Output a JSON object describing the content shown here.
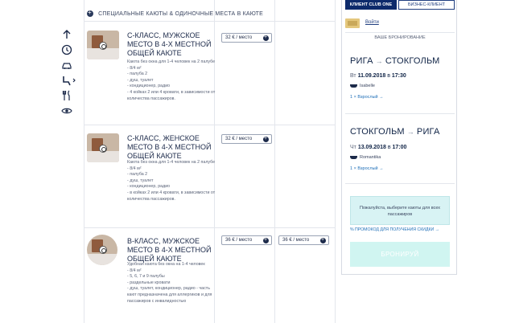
{
  "section_header": "СПЕЦИАЛЬНЫЕ КАЮТЫ & ОДИНОЧНЫЕ МЕСТА В КАЮТЕ",
  "side_nav_icons": [
    "arrow-up-icon",
    "clock-icon",
    "car-icon",
    "seat-icon",
    "restaurant-icon",
    "eye-icon"
  ],
  "cabins": [
    {
      "title": "С-КЛАСС, МУЖСКОЕ МЕСТО  В 4-Х МЕСТНОЙ ОБЩЕЙ КАЮТЕ",
      "description": "Каюта без окна для 1-4 человек на 2 палубе\n- 8/4 м²\n- палуба 2\n- душ, туалет\n- кондиционер, радио\n- 4 койках 2 или 4 кровати, в зависимости от количества пассажиров.",
      "price_outbound": "32 € / место",
      "price_return": ""
    },
    {
      "title": "С-КЛАСС, ЖЕНСКОЕ МЕСТО  В 4-Х МЕСТНОЙ ОБЩЕЙ КАЮТЕ",
      "description": "Каюта без окна для 1-4 человек на 2 палубе\n- 8/4 м²\n- палуба 2\n- душ, туалет\n- кондиционер, радио\n- в койках 2 или 4 кровати, в зависимости от количества пассажиров.",
      "price_outbound": "32 € / место",
      "price_return": ""
    },
    {
      "title": "В-КЛАСС, МУЖСКОЕ МЕСТО  В 4-Х МЕСТНОЙ ОБЩЕЙ КАЮТЕ",
      "description": "Удобная каюта без окна на 1-4 человек\n- 8/4 м²\n- 5, 6, 7 и 9 палубы\n- раздельные кровати\n- душ, туалет, кондиционер, радио - часть кают предназначена для аллергиков и для пассажиров с инвалидностью",
      "price_outbound": "36 € / место",
      "price_return": "36 € / место"
    }
  ],
  "panel": {
    "tab_club": "КЛИЕНТ CLUB ONE",
    "tab_business": "БИЗНЕС-КЛИЕНТ",
    "login": "Войти",
    "your_booking": "ВАШЕ БРОНИРОВАНИЕ",
    "trips": [
      {
        "from": "РИГА",
        "to": "СТОКГОЛЬМ",
        "weekday": "Вт",
        "date": "11.09.2018",
        "at": "в",
        "time": "17:30",
        "ship": "Isabelle",
        "pax": "1 × Взрослый →"
      },
      {
        "from": "СТОКГОЛЬМ",
        "to": "РИГА",
        "weekday": "Чт",
        "date": "13.09.2018",
        "at": "в",
        "time": "17:00",
        "ship": "Romantika",
        "pax": "1 × Взрослый →"
      }
    ],
    "notice": "Пожалуйста, выберите каюты для всех пассажиров",
    "promo": "% ПРОМОКОД ДЛЯ ПОЛУЧЕНИЯ СКИДКИ →",
    "book_button": "БРОНИРУЙ"
  }
}
